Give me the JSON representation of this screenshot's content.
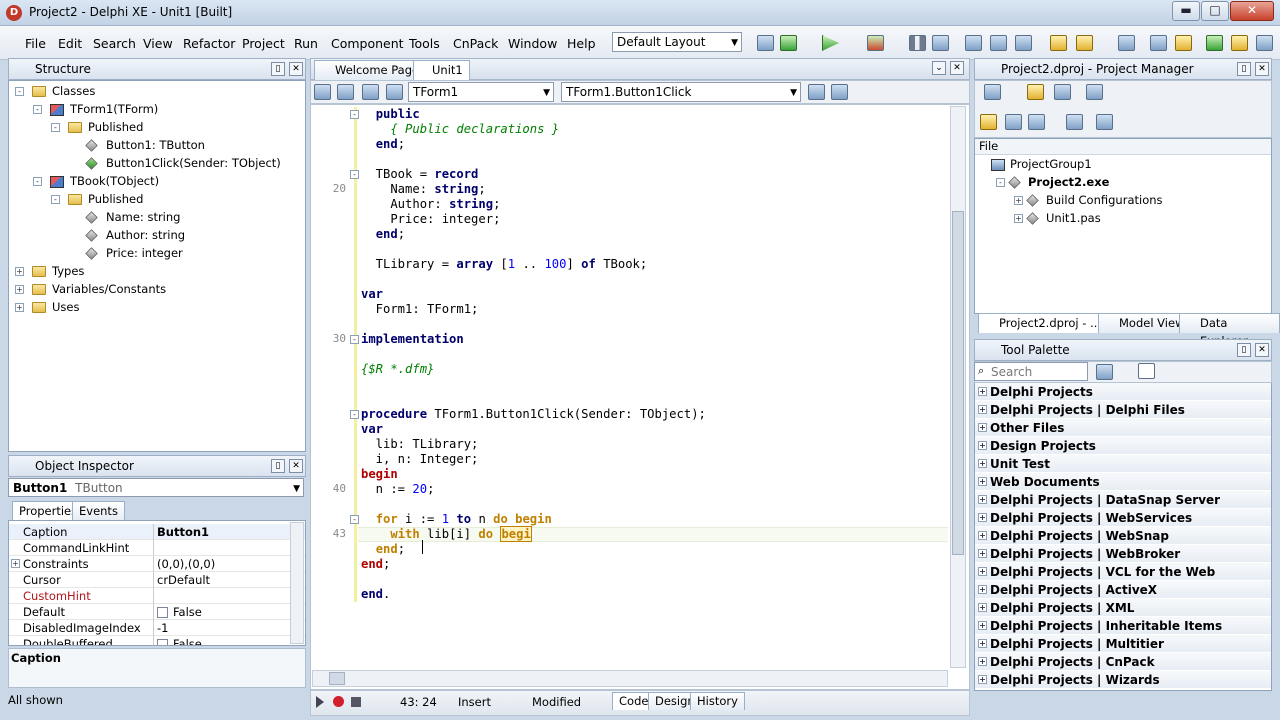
{
  "window": {
    "title": "Project2 - Delphi XE - Unit1 [Built]",
    "min": "▬",
    "max": "□",
    "close": "✕"
  },
  "menu": [
    "File",
    "Edit",
    "Search",
    "View",
    "Refactor",
    "Project",
    "Run",
    "Component",
    "Tools",
    "CnPack",
    "Window",
    "Help"
  ],
  "layout_combo": "Default Layout",
  "structure": {
    "title": "Structure",
    "rows": [
      {
        "label": "Classes",
        "indent": 0,
        "icon": "folder-icon",
        "exp": "-"
      },
      {
        "label": "TForm1(TForm)",
        "indent": 1,
        "icon": "class-icon",
        "exp": "-"
      },
      {
        "label": "Published",
        "indent": 2,
        "icon": "folder-icon",
        "exp": "-"
      },
      {
        "label": "Button1: TButton",
        "indent": 3,
        "icon": "field-icon",
        "exp": ""
      },
      {
        "label": "Button1Click(Sender: TObject)",
        "indent": 3,
        "icon": "method-icon",
        "exp": ""
      },
      {
        "label": "TBook(TObject)",
        "indent": 1,
        "icon": "class-icon",
        "exp": "-"
      },
      {
        "label": "Published",
        "indent": 2,
        "icon": "folder-icon",
        "exp": "-"
      },
      {
        "label": "Name: string",
        "indent": 3,
        "icon": "field-icon",
        "exp": ""
      },
      {
        "label": "Author: string",
        "indent": 3,
        "icon": "field-icon",
        "exp": ""
      },
      {
        "label": "Price: integer",
        "indent": 3,
        "icon": "field-icon",
        "exp": ""
      },
      {
        "label": "Types",
        "indent": 0,
        "icon": "folder-icon",
        "exp": "+"
      },
      {
        "label": "Variables/Constants",
        "indent": 0,
        "icon": "folder-icon",
        "exp": "+"
      },
      {
        "label": "Uses",
        "indent": 0,
        "icon": "folder-icon",
        "exp": "+"
      }
    ]
  },
  "inspector": {
    "title": "Object Inspector",
    "object": "Button1",
    "object_type": "TButton",
    "tabs": [
      "Properties",
      "Events"
    ],
    "rows": [
      {
        "name": "Caption",
        "value": "Button1",
        "exp": "",
        "bold": true
      },
      {
        "name": "CommandLinkHint",
        "value": "",
        "exp": ""
      },
      {
        "name": "Constraints",
        "value": "(0,0),(0,0)",
        "exp": "+"
      },
      {
        "name": "Cursor",
        "value": "crDefault",
        "exp": ""
      },
      {
        "name": "CustomHint",
        "value": "",
        "exp": "",
        "red": true
      },
      {
        "name": "Default",
        "value": "False",
        "exp": "",
        "check": true
      },
      {
        "name": "DisabledImageIndex",
        "value": "-1",
        "exp": ""
      },
      {
        "name": "DoubleBuffered",
        "value": "False",
        "exp": "",
        "check": true
      }
    ],
    "footer": "Caption",
    "status": "All shown"
  },
  "editor": {
    "tabs": [
      "Welcome Page",
      "Unit1"
    ],
    "class_combo": "TForm1",
    "method_combo": "TForm1.Button1Click",
    "lines": [
      {
        "n": "",
        "html": "  <span class='kw'>public</span>"
      },
      {
        "n": "",
        "html": "    <span class='cm'>{ Public declarations }</span>"
      },
      {
        "n": "",
        "html": "  <span class='kw'>end</span>;"
      },
      {
        "n": "",
        "html": ""
      },
      {
        "n": "",
        "html": "  TBook = <span class='kw'>record</span>"
      },
      {
        "n": "20",
        "html": "    Name: <span class='kw'>string</span>;"
      },
      {
        "n": "",
        "html": "    Author: <span class='kw'>string</span>;"
      },
      {
        "n": "",
        "html": "    Price: integer;"
      },
      {
        "n": "",
        "html": "  <span class='kw'>end</span>;"
      },
      {
        "n": "",
        "html": ""
      },
      {
        "n": "",
        "html": "  TLibrary = <span class='kw'>array</span> [<span class='nm'>1</span> .. <span class='nm'>100</span>] <span class='kw'>of</span> TBook;"
      },
      {
        "n": "",
        "html": ""
      },
      {
        "n": "",
        "html": "<span class='kw'>var</span>"
      },
      {
        "n": "",
        "html": "  Form1: TForm1;"
      },
      {
        "n": "",
        "html": ""
      },
      {
        "n": "30",
        "html": "<span class='kw'>implementation</span>"
      },
      {
        "n": "",
        "html": ""
      },
      {
        "n": "",
        "html": "<span class='cm'>{$R *.dfm}</span>"
      },
      {
        "n": "",
        "html": ""
      },
      {
        "n": "",
        "html": ""
      },
      {
        "n": "",
        "html": "<span class='kw'>procedure</span> TForm1.Button1Click(Sender: TObject);"
      },
      {
        "n": "",
        "html": "<span class='kw'>var</span>"
      },
      {
        "n": "",
        "html": "  lib: TLibrary;"
      },
      {
        "n": "",
        "html": "  i, n: Integer;"
      },
      {
        "n": "",
        "html": "<span class='kw red'>begin</span>"
      },
      {
        "n": "40",
        "html": "  n := <span class='nm'>20</span>;"
      },
      {
        "n": "",
        "html": ""
      },
      {
        "n": "",
        "html": "  <span class='kw' style='color:#c08000'>for</span> i := <span class='nm'>1</span> <span class='kw'>to</span> n <span class='kw' style='color:#c08000'>do begin</span>"
      },
      {
        "n": "43",
        "html": "    <span class='kw' style='color:#c08000'>with</span> lib[i] <span class='kw' style='color:#c08000'>do</span> <span class='kw' style='color:#c08000;border:1px solid #c08000;background:#fff4c6'>begi</span>"
      },
      {
        "n": "",
        "html": "  <span class='kw' style='color:#c08000'>end</span>;"
      },
      {
        "n": "",
        "html": "<span class='kw red'>end</span>;"
      },
      {
        "n": "",
        "html": ""
      },
      {
        "n": "",
        "html": "<span class='kw'>end</span>."
      }
    ],
    "status": {
      "pos": "43: 24",
      "mode": "Insert",
      "state": "Modified"
    },
    "bottom_tabs": [
      "Code",
      "Design",
      "History"
    ]
  },
  "project": {
    "title": "Project2.dproj - Project Manager",
    "header": "File",
    "rows": [
      {
        "label": "ProjectGroup1",
        "indent": 0,
        "exp": "",
        "bold": false
      },
      {
        "label": "Project2.exe",
        "indent": 1,
        "exp": "-",
        "bold": true
      },
      {
        "label": "Build Configurations",
        "indent": 2,
        "exp": "+",
        "bold": false
      },
      {
        "label": "Unit1.pas",
        "indent": 2,
        "exp": "+",
        "bold": false
      }
    ],
    "tabs": [
      "Project2.dproj - ...",
      "Model View",
      "Data Explorer"
    ]
  },
  "palette": {
    "title": "Tool Palette",
    "search_placeholder": "Search",
    "items": [
      "Delphi Projects",
      "Delphi Projects | Delphi Files",
      "Other Files",
      "Design Projects",
      "Unit Test",
      "Web Documents",
      "Delphi Projects | DataSnap Server",
      "Delphi Projects | WebServices",
      "Delphi Projects | WebSnap",
      "Delphi Projects | WebBroker",
      "Delphi Projects | VCL for the Web",
      "Delphi Projects | ActiveX",
      "Delphi Projects | XML",
      "Delphi Projects | Inheritable Items",
      "Delphi Projects | Multitier",
      "Delphi Projects | CnPack",
      "Delphi Projects | Wizards"
    ]
  }
}
